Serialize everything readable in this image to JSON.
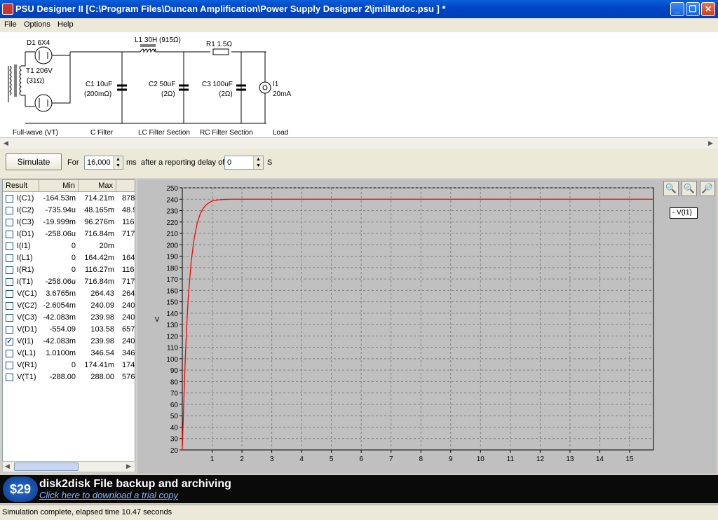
{
  "window": {
    "title": "PSU Designer II  [C:\\Program Files\\Duncan Amplification\\Power Supply Designer 2\\jmillardoc.psu ] *"
  },
  "menu": {
    "items": [
      "File",
      "Options",
      "Help"
    ]
  },
  "schematic": {
    "d1": "D1 6X4",
    "t1": [
      "T1 206V",
      "(31Ω)"
    ],
    "l1": "L1 30H (915Ω)",
    "r1": "R1 1.5Ω",
    "c1": [
      "C1 10uF",
      "(200mΩ)"
    ],
    "c2": [
      "C2 50uF",
      "(2Ω)"
    ],
    "c3": [
      "C3 100uF",
      "(2Ω)"
    ],
    "i1": [
      "I1",
      "20mA"
    ],
    "sections": [
      "Full-wave (VT)",
      "C Filter",
      "LC Filter Section",
      "RC Filter Section",
      "Load"
    ]
  },
  "toolbar": {
    "simulate": "Simulate",
    "for": "For",
    "duration": "16,000",
    "ms": "ms",
    "delay_label": "after a reporting delay of",
    "delay": "0",
    "s": "S"
  },
  "results": {
    "headers": [
      "Result",
      "Min",
      "Max"
    ],
    "rows": [
      {
        "name": "I(C1)",
        "min": "-164.53m",
        "max": "714.21m",
        "extra": "878.",
        "checked": false
      },
      {
        "name": "I(C2)",
        "min": "-735.94u",
        "max": "48.165m",
        "extra": "48.9",
        "checked": false
      },
      {
        "name": "I(C3)",
        "min": "-19.999m",
        "max": "96.276m",
        "extra": "116.",
        "checked": false
      },
      {
        "name": "I(D1)",
        "min": "-258.06u",
        "max": "716.84m",
        "extra": "717.",
        "checked": false
      },
      {
        "name": "I(I1)",
        "min": "0",
        "max": "20m",
        "extra": "",
        "checked": false
      },
      {
        "name": "I(L1)",
        "min": "0",
        "max": "164.42m",
        "extra": "164.",
        "checked": false
      },
      {
        "name": "I(R1)",
        "min": "0",
        "max": "116.27m",
        "extra": "116.",
        "checked": false
      },
      {
        "name": "I(T1)",
        "min": "-258.06u",
        "max": "716.84m",
        "extra": "717.",
        "checked": false
      },
      {
        "name": "V(C1)",
        "min": "3.6765m",
        "max": "264.43",
        "extra": "264",
        "checked": false
      },
      {
        "name": "V(C2)",
        "min": "-2.6054m",
        "max": "240.09",
        "extra": "240",
        "checked": false
      },
      {
        "name": "V(C3)",
        "min": "-42.083m",
        "max": "239.98",
        "extra": "240",
        "checked": false
      },
      {
        "name": "V(D1)",
        "min": "-554.09",
        "max": "103.58",
        "extra": "657",
        "checked": false
      },
      {
        "name": "V(I1)",
        "min": "-42.083m",
        "max": "239.98",
        "extra": "240",
        "checked": true
      },
      {
        "name": "V(L1)",
        "min": "1.0100m",
        "max": "346.54",
        "extra": "346",
        "checked": false
      },
      {
        "name": "V(R1)",
        "min": "0",
        "max": "174.41m",
        "extra": "174.",
        "checked": false
      },
      {
        "name": "V(T1)",
        "min": "-288.00",
        "max": "288.00",
        "extra": "576",
        "checked": false
      }
    ]
  },
  "chart_data": {
    "type": "line",
    "ylabel": "V",
    "xlabel": "",
    "xlim": [
      0,
      15.8
    ],
    "ylim": [
      20,
      250
    ],
    "xticks": [
      1,
      2,
      3,
      4,
      5,
      6,
      7,
      8,
      9,
      10,
      11,
      12,
      13,
      14,
      15
    ],
    "yticks": [
      20,
      30,
      40,
      50,
      60,
      70,
      80,
      90,
      100,
      110,
      120,
      130,
      140,
      150,
      160,
      170,
      180,
      190,
      200,
      210,
      220,
      230,
      240,
      250
    ],
    "grid": true,
    "legend_position": "right",
    "series": [
      {
        "name": "V(I1)",
        "color": "#ff0000",
        "x": [
          0,
          0.05,
          0.1,
          0.15,
          0.2,
          0.3,
          0.4,
          0.5,
          0.6,
          0.7,
          0.8,
          0.9,
          1.0,
          1.2,
          1.4,
          1.6,
          2.0,
          3.0,
          6.0,
          10.0,
          15.8
        ],
        "y": [
          20,
          62,
          100,
          130,
          154,
          186,
          206,
          219,
          227,
          232,
          235,
          237,
          238.5,
          239.4,
          239.8,
          240,
          240,
          240,
          240,
          240,
          240
        ]
      }
    ]
  },
  "banner": {
    "price": "$29",
    "headline": "disk2disk File backup and archiving",
    "link": "Click here to download a trial copy"
  },
  "status": {
    "text": "Simulation complete, elapsed time 10.47 seconds"
  },
  "colors": {
    "titlebar": "#0046c8",
    "trace": "#ff0000",
    "chart_bg": "#c0c0c0"
  }
}
